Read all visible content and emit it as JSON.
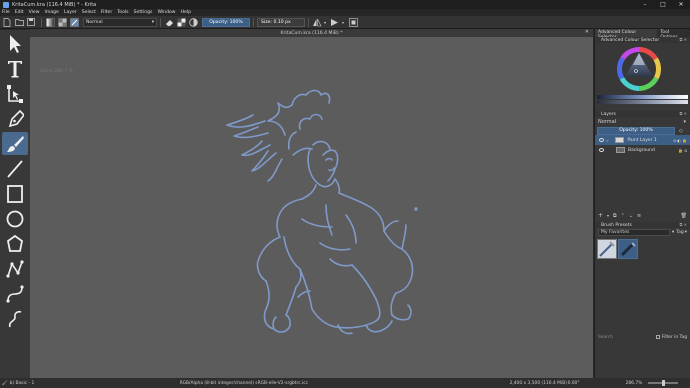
{
  "window": {
    "title": "KritaCum.kra (116.4 MiB) * - Krita",
    "controls": [
      "–",
      "□",
      "✕"
    ]
  },
  "menu": [
    "File",
    "Edit",
    "View",
    "Image",
    "Layer",
    "Select",
    "Filter",
    "Tools",
    "Settings",
    "Window",
    "Help"
  ],
  "toolbar": {
    "blend_mode": "Normal",
    "opacity": "Opacity: 100%",
    "size": "Size: 0.10 px"
  },
  "canvas": {
    "tab_title": "KritaCum.kra (116.4 MiB) *",
    "zoom_overlay": "Zoom 286.7 %",
    "background_color": "#5c5c5c",
    "stroke_color": "#7f99c9"
  },
  "dock": {
    "tabs": [
      "Advanced Colour Selector",
      "Tool Options"
    ],
    "color_selector_title": "Advanced Colour Selector",
    "layers_title": "Layers",
    "layer_blend": "Normal",
    "layer_opacity": "Opacity: 100%",
    "layers": [
      {
        "name": "Paint Layer 1",
        "selected": true
      },
      {
        "name": "Background",
        "selected": false
      }
    ],
    "brush_presets_title": "Brush Presets",
    "preset_tag": "My Favorites",
    "tag_label": "Tag",
    "search_placeholder": "Search",
    "filter_label": "Filter in Tag"
  },
  "status": {
    "brush": "b) Basic - 1",
    "color_info": "RGB/Alpha (8-bit integer/channel)  sRGB-elle-V2-srgbtrc.icc",
    "dimensions": "2,400 x 3,500 (116.4 MiB)",
    "rotation": "0.00°",
    "zoom": "286.7%"
  }
}
